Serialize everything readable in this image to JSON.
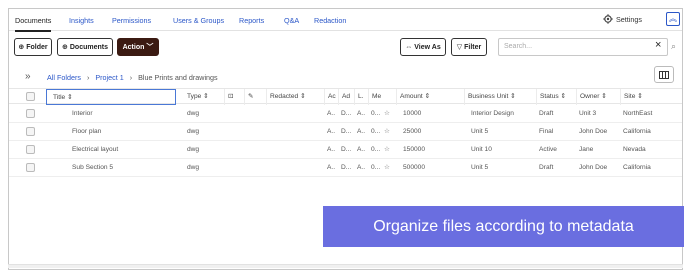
{
  "nav": {
    "tabs": [
      "Documents",
      "Insights",
      "Permissions",
      "Users & Groups",
      "Reports",
      "Q&A",
      "Redaction"
    ],
    "settings_label": "Settings",
    "collapse_glyph": "︽"
  },
  "toolbar": {
    "folder_label": "Folder",
    "documents_label": "Documents",
    "action_label": "Action",
    "view_as_label": "View As",
    "filter_label": "Filter",
    "search_placeholder": "Search..."
  },
  "breadcrumb": {
    "root": "All Folders",
    "project": "Project 1",
    "current": "Blue Prints and drawings"
  },
  "table": {
    "headers": {
      "title": "Title",
      "type": "Type",
      "redacted": "Redacted",
      "ac": "Ac",
      "ad": "Ad",
      "l": "L.",
      "me": "Me",
      "amount": "Amount",
      "business_unit": "Business Unit",
      "status": "Status",
      "owner": "Owner",
      "site": "Site"
    },
    "rows": [
      {
        "title": "Interior",
        "type": "dwg",
        "ac": "A..",
        "ad": "D...",
        "l": "A..",
        "me": "0...",
        "amount": "10000",
        "business_unit": "Interior Design",
        "status": "Draft",
        "owner": "Unit 3",
        "site": "NorthEast"
      },
      {
        "title": "Floor plan",
        "type": "dwg",
        "ac": "A..",
        "ad": "D...",
        "l": "A..",
        "me": "0...",
        "amount": "25000",
        "business_unit": "Unit 5",
        "status": "Final",
        "owner": "John Doe",
        "site": "California"
      },
      {
        "title": "Electrical layout",
        "type": "dwg",
        "ac": "A..",
        "ad": "D...",
        "l": "A..",
        "me": "0...",
        "amount": "150000",
        "business_unit": "Unit 10",
        "status": "Active",
        "owner": "Jane",
        "site": "Nevada"
      },
      {
        "title": "Sub Section 5",
        "type": "dwg",
        "ac": "A..",
        "ad": "D...",
        "l": "A..",
        "me": "0...",
        "amount": "500000",
        "business_unit": "Unit 5",
        "status": "Draft",
        "owner": "John Doe",
        "site": "California"
      }
    ]
  },
  "banner": {
    "text": "Organize files according to metadata",
    "color": "#6a6ee0"
  }
}
